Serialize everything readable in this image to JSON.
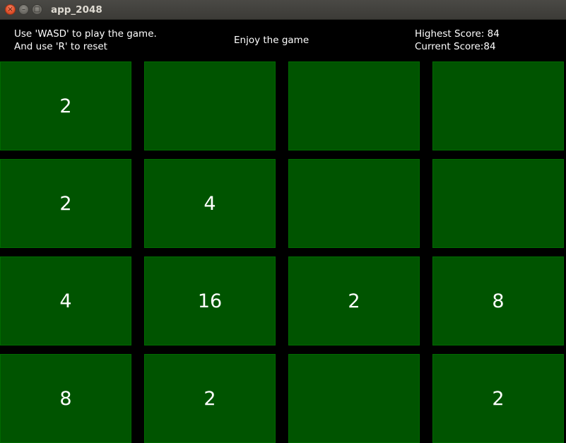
{
  "window": {
    "title": "app_2048",
    "close_glyph": "×",
    "minimize_glyph": "–",
    "maximize_glyph": "□"
  },
  "header": {
    "instruction_line1": "Use 'WASD' to play the game.",
    "instruction_line2": "And use 'R' to reset",
    "message": "Enjoy the game",
    "highest_score": "Highest Score: 84",
    "current_score": "Current Score:84"
  },
  "colors": {
    "tile": "#005400",
    "background": "#000000",
    "text": "#ffffff"
  },
  "board": {
    "rows": [
      [
        "2",
        "",
        "",
        ""
      ],
      [
        "2",
        "4",
        "",
        ""
      ],
      [
        "4",
        "16",
        "2",
        "8"
      ],
      [
        "8",
        "2",
        "",
        "2"
      ]
    ]
  }
}
